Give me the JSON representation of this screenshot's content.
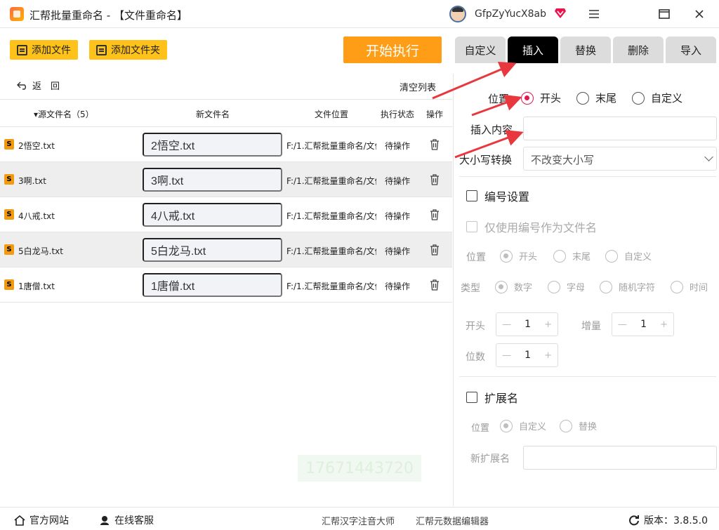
{
  "window": {
    "title": "汇帮批量重命名 - 【文件重命名】",
    "username": "GfpZyYucX8ab"
  },
  "toolbar": {
    "add_files": "添加文件",
    "add_folder": "添加文件夹",
    "start": "开始执行"
  },
  "tabs": [
    "自定义",
    "插入",
    "替换",
    "删除",
    "导入"
  ],
  "list": {
    "back": "返　回",
    "clear": "清空列表",
    "headers": {
      "source": "▾源文件名（5）",
      "new": "新文件名",
      "location": "文件位置",
      "status": "执行状态",
      "action": "操作"
    },
    "rows": [
      {
        "src": "2悟空.txt",
        "new": "2悟空.txt",
        "loc": "F:/1.汇帮批量重命名/文件",
        "status": "待操作"
      },
      {
        "src": "3啊.txt",
        "new": "3啊.txt",
        "loc": "F:/1.汇帮批量重命名/文件",
        "status": "待操作"
      },
      {
        "src": "4八戒.txt",
        "new": "4八戒.txt",
        "loc": "F:/1.汇帮批量重命名/文件",
        "status": "待操作"
      },
      {
        "src": "5白龙马.txt",
        "new": "5白龙马.txt",
        "loc": "F:/1.汇帮批量重命名/文件",
        "status": "待操作"
      },
      {
        "src": "1唐僧.txt",
        "new": "1唐僧.txt",
        "loc": "F:/1.汇帮批量重命名/文件",
        "status": "待操作"
      }
    ],
    "watermark": "17671443720"
  },
  "panel": {
    "position_label": "位置",
    "position_options": [
      "开头",
      "末尾",
      "自定义"
    ],
    "insert_label": "插入内容",
    "insert_value": "",
    "case_label": "大小写转换",
    "case_value": "不改变大小写",
    "numbering": {
      "title": "编号设置",
      "only_number": "仅使用编号作为文件名",
      "position_label": "位置",
      "position_options": [
        "开头",
        "末尾",
        "自定义"
      ],
      "type_label": "类型",
      "type_options": [
        "数字",
        "字母",
        "随机字符",
        "时间"
      ],
      "start_label": "开头",
      "start_value": "1",
      "step_label": "增量",
      "step_value": "1",
      "digits_label": "位数",
      "digits_value": "1"
    },
    "extension": {
      "title": "扩展名",
      "position_label": "位置",
      "options": [
        "自定义",
        "替换"
      ],
      "new_ext_label": "新扩展名"
    }
  },
  "footer": {
    "website": "官方网站",
    "support": "在线客服",
    "link1": "汇帮汉字注音大师",
    "link2": "汇帮元数据编辑器",
    "version": "版本：3.8.5.0"
  },
  "colors": {
    "accent_yellow": "#ffc21a",
    "start_orange": "#ff9d16",
    "radio_red": "#e8144e",
    "arrow_red": "#e8383d"
  }
}
